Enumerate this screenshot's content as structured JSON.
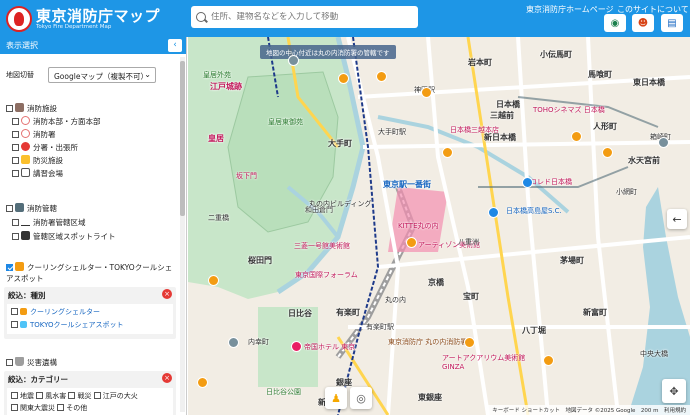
{
  "header": {
    "title": "東京消防庁マップ",
    "subtitle": "Tokyo Fire Department Map",
    "search_placeholder": "住所、建物名などを入力して移動",
    "link_home": "東京消防庁ホームページ",
    "link_about": "このサイトについて"
  },
  "sidebar": {
    "heading": "表示選択",
    "collapse_glyph": "‹",
    "map_switch_label": "地図切替",
    "map_switch_value": "Googleマップ（複製不可）",
    "groups": {
      "facilities": {
        "label": "消防施設",
        "items": [
          "消防本部・方面本部",
          "消防署",
          "分署・出張所",
          "防災施設",
          "講習会場"
        ]
      },
      "jurisdiction": {
        "label": "消防管轄",
        "items": [
          "消防署管轄区域",
          "管轄区域スポットライト"
        ]
      },
      "cooling": {
        "label": "クーリングシェルター・TOKYOクールシェアスポット",
        "filter_title": "絞込：種別",
        "options": [
          "クーリングシェルター",
          "TOKYOクールシェアスポット"
        ]
      },
      "disaster": {
        "label": "災害遺構",
        "filter_title": "絞込：カテゴリー",
        "options": [
          "地震",
          "風水害",
          "戦災",
          "江戸の大火",
          "関東大震災",
          "その他"
        ]
      }
    }
  },
  "map": {
    "notice": "地図の中心付近は丸の内消防署の管轄です",
    "labels": [
      "皇居外苑",
      "江戸城跡",
      "皇居",
      "皇居東御苑",
      "坂下門",
      "二重橋",
      "和田倉門",
      "大手町",
      "丸の内ビルディング",
      "東京駅一番街",
      "KITTE丸の内",
      "三菱一号館美術館",
      "アーティゾン美術館",
      "東京国際フォーラム",
      "有楽町",
      "日比谷",
      "帝国ホテル 東京",
      "アートアクアリウム美術館 GINZA",
      "銀座",
      "日本橋",
      "三越前",
      "日本橋三越本店",
      "TOHOシネマズ 日本橋",
      "コレド日本橋",
      "人形町",
      "水天宮前",
      "八丁堀",
      "中央大橋",
      "新日本橋",
      "小伝馬町",
      "馬喰町",
      "京橋",
      "宝町",
      "日本橋高島屋S.C.",
      "丸の内",
      "日比谷公園",
      "有楽町駅",
      "東銀座",
      "茅場町",
      "小網町",
      "箱崎町",
      "八重洲",
      "大手町駅",
      "神田駅",
      "岩本町",
      "東日本橋",
      "東京消防庁 丸の内消防署",
      "新富町",
      "桜田門",
      "内幸町",
      "新橋"
    ],
    "footer": "キーボード ショートカット　地図データ ©2025 Google　200 m　利用規約",
    "icons": [
      "fire-station-icon",
      "cooling-shelter-icon",
      "locate-icon",
      "fullscreen-icon",
      "pegman-icon"
    ]
  },
  "colors": {
    "brand": "#1e96e6",
    "park": "#c8e6c9",
    "water": "#aad3df",
    "road": "#ffffff",
    "highlight": "#f48fb1",
    "jurisdiction_outline": "#1e3a8a"
  }
}
